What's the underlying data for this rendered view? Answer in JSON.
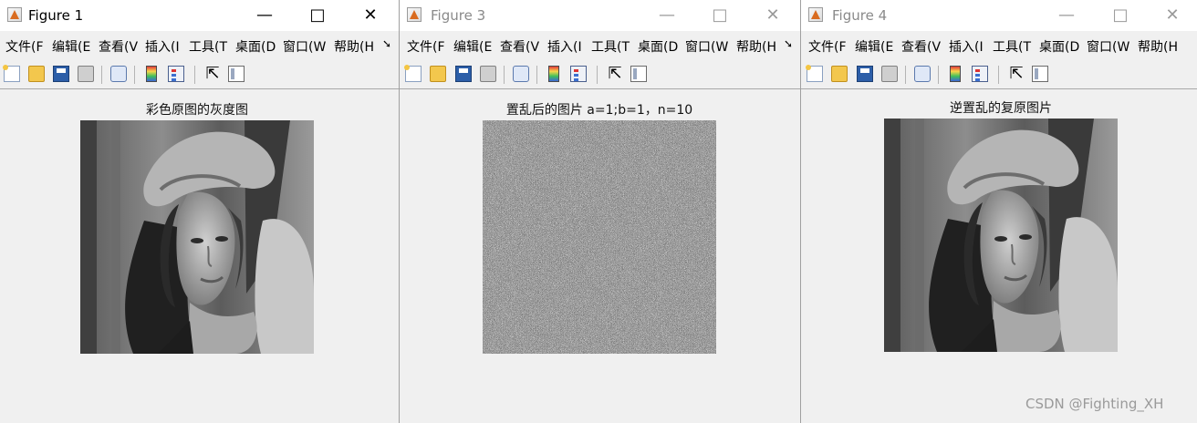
{
  "windows": [
    {
      "title": "Figure 1",
      "active": true,
      "menus": [
        "文件(F",
        "编辑(E",
        "查看(V",
        "插入(I",
        "工具(T",
        "桌面(D",
        "窗口(W",
        "帮助(H"
      ],
      "axes_title": "彩色原图的灰度图",
      "image": "grayscale-portrait-woman-with-hat"
    },
    {
      "title": "Figure 3",
      "active": false,
      "menus": [
        "文件(F",
        "编辑(E",
        "查看(V",
        "插入(I",
        "工具(T",
        "桌面(D",
        "窗口(W",
        "帮助(H"
      ],
      "axes_title": "置乱后的图片 a=1;b=1，n=10",
      "image": "scrambled-noise"
    },
    {
      "title": "Figure 4",
      "active": false,
      "menus": [
        "文件(F",
        "编辑(E",
        "查看(V",
        "插入(I",
        "工具(T",
        "桌面(D",
        "窗口(W",
        "帮助(H"
      ],
      "axes_title": "逆置乱的复原图片",
      "image": "grayscale-portrait-woman-with-hat"
    }
  ],
  "watermark": "CSDN @Fighting_XH",
  "colors": {
    "titlebar_bg": "#ffffff",
    "window_bg": "#f0f0f0",
    "inactive_text": "#8a8a8a",
    "matlab_icon": "#d96b1f"
  }
}
